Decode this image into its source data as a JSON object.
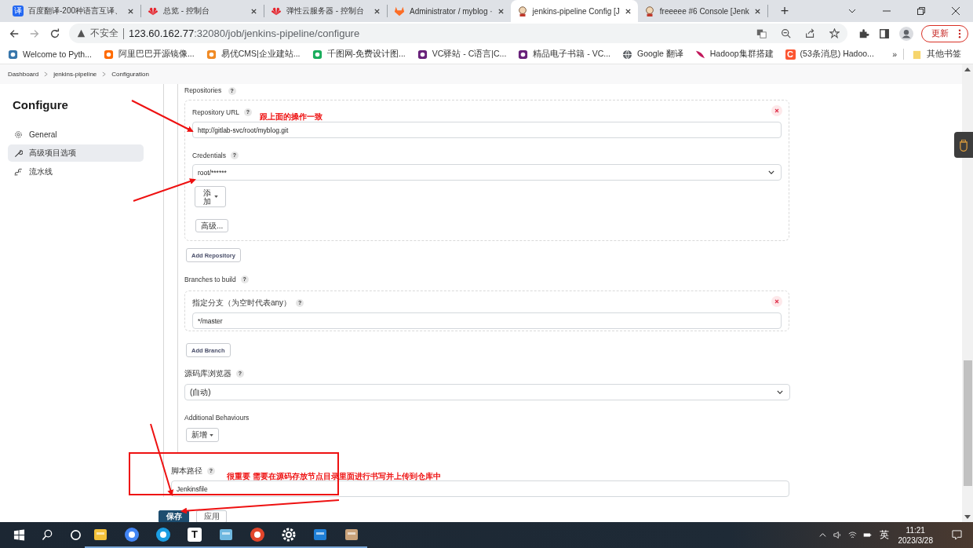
{
  "browser": {
    "tabs": [
      {
        "title": "百度翻译-200种语言互译、",
        "kind": "translate",
        "badge": "译",
        "selected": false
      },
      {
        "title": "总览 - 控制台",
        "kind": "huawei",
        "selected": false
      },
      {
        "title": "弹性云服务器 - 控制台",
        "kind": "huawei",
        "selected": false
      },
      {
        "title": "Administrator / myblog ·",
        "kind": "gitlab",
        "selected": false
      },
      {
        "title": "jenkins-pipeline Config [J",
        "kind": "jenkins",
        "selected": true
      },
      {
        "title": "freeeee #6 Console [Jenk",
        "kind": "jenkins",
        "selected": false
      }
    ],
    "new_tab": "+",
    "security": "不安全",
    "url_host": "123.60.162.77",
    "url_rest": ":32080/job/jenkins-pipeline/configure",
    "update_button": "更新",
    "bookmarks": [
      {
        "title": "Welcome to Pyth...",
        "kind": "python"
      },
      {
        "title": "阿里巴巴开源镜像...",
        "kind": "aliyun"
      },
      {
        "title": "易优CMS|企业建站...",
        "kind": "eyou"
      },
      {
        "title": "千图网-免费设计图...",
        "kind": "qiantu"
      },
      {
        "title": "VC驿站 - C语言|C...",
        "kind": "vs"
      },
      {
        "title": "精品电子书籍 - VC...",
        "kind": "vs"
      },
      {
        "title": "Google 翻译",
        "kind": "globe"
      },
      {
        "title": "Hadoop集群搭建",
        "kind": "feather"
      },
      {
        "title": "(53条消息) Hadoo...",
        "kind": "csdn",
        "badge": "C"
      }
    ],
    "more": "»",
    "other_bookmarks": "其他书签"
  },
  "breadcrumb": [
    "Dashboard",
    "jenkins-pipeline",
    "Configuration"
  ],
  "sidebar": {
    "title": "Configure",
    "items": [
      {
        "label": "General",
        "kind": "gear",
        "selected": false
      },
      {
        "label": "高级项目选项",
        "kind": "wrench",
        "selected": true
      },
      {
        "label": "流水线",
        "kind": "pipeline",
        "selected": false
      }
    ]
  },
  "form": {
    "repositories": {
      "text": "Repositories",
      "help": "?"
    },
    "repository": {
      "url_label": {
        "text": "Repository URL",
        "help": "?"
      },
      "url": "http://gitlab-svc/root/myblog.git",
      "credentials_label": {
        "text": "Credentials",
        "help": "?"
      },
      "credentials": "root/******",
      "add_button": "添加",
      "advanced_button": "高级..."
    },
    "add_repository": "Add Repository",
    "branches": {
      "text": "Branches to build",
      "help": "?"
    },
    "branch": {
      "label": {
        "text": "指定分支（为空时代表any）",
        "help": "?"
      },
      "value": "*/master"
    },
    "add_branch": "Add Branch",
    "source_browser": {
      "text": "源码库浏览器",
      "help": "?"
    },
    "source_browser_value": "(自动)",
    "behaviours": {
      "text": "Additional Behaviours"
    },
    "behaviours_button": "新增",
    "script_path": {
      "text": "脚本路径",
      "help": "?"
    },
    "script_path_value": "Jenkinsfile"
  },
  "buttons": [
    {
      "label": "保存",
      "kind": "primary"
    },
    {
      "label": "应用",
      "kind": "secondary"
    }
  ],
  "annotations": [
    "跟上面的操作一致",
    "很重要  需要在源码存放节点目录里面进行书写并上传到仓库中"
  ],
  "taskbar": {
    "apps": [
      {
        "kind": "folder"
      },
      {
        "kind": "chrome"
      },
      {
        "kind": "edge"
      },
      {
        "kind": "typora",
        "badge": "T"
      },
      {
        "kind": "notepad"
      },
      {
        "kind": "swirl"
      },
      {
        "kind": "settings"
      },
      {
        "kind": "media"
      },
      {
        "kind": "paint"
      }
    ],
    "ime": "英",
    "time": "11:21",
    "date": "2023/3/28"
  }
}
